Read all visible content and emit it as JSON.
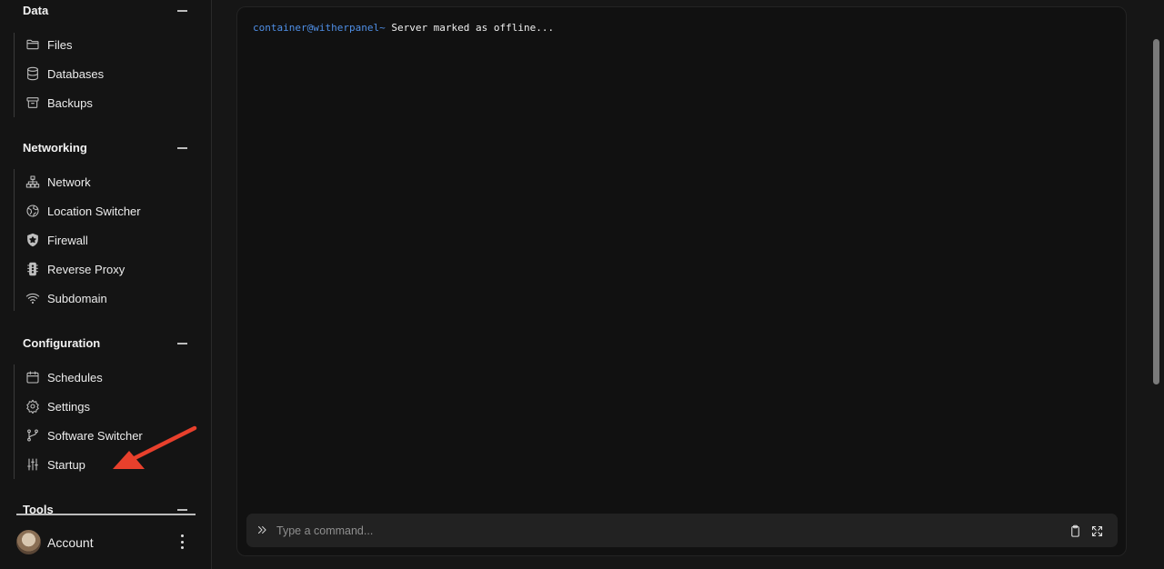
{
  "sidebar": {
    "sections": [
      {
        "title": "Data",
        "items": [
          {
            "label": "Files",
            "icon": "folder-icon"
          },
          {
            "label": "Databases",
            "icon": "database-icon"
          },
          {
            "label": "Backups",
            "icon": "archive-icon"
          }
        ]
      },
      {
        "title": "Networking",
        "items": [
          {
            "label": "Network",
            "icon": "network-icon"
          },
          {
            "label": "Location Switcher",
            "icon": "globe-icon"
          },
          {
            "label": "Firewall",
            "icon": "shield-icon"
          },
          {
            "label": "Reverse Proxy",
            "icon": "traffic-light-icon"
          },
          {
            "label": "Subdomain",
            "icon": "wifi-icon"
          }
        ]
      },
      {
        "title": "Configuration",
        "items": [
          {
            "label": "Schedules",
            "icon": "calendar-icon"
          },
          {
            "label": "Settings",
            "icon": "gear-icon"
          },
          {
            "label": "Software Switcher",
            "icon": "git-branch-icon"
          },
          {
            "label": "Startup",
            "icon": "sliders-icon"
          }
        ]
      },
      {
        "title": "Tools",
        "items": []
      }
    ],
    "account": {
      "label": "Account",
      "icon": "avatar"
    }
  },
  "console": {
    "prompt": "container@witherpanel~",
    "message": " Server marked as offline...",
    "prompt_color": "#4f8fe6"
  },
  "command": {
    "placeholder": "Type a command...",
    "value": ""
  },
  "annotation": {
    "arrow_color": "#e8402c",
    "target": "Startup"
  }
}
